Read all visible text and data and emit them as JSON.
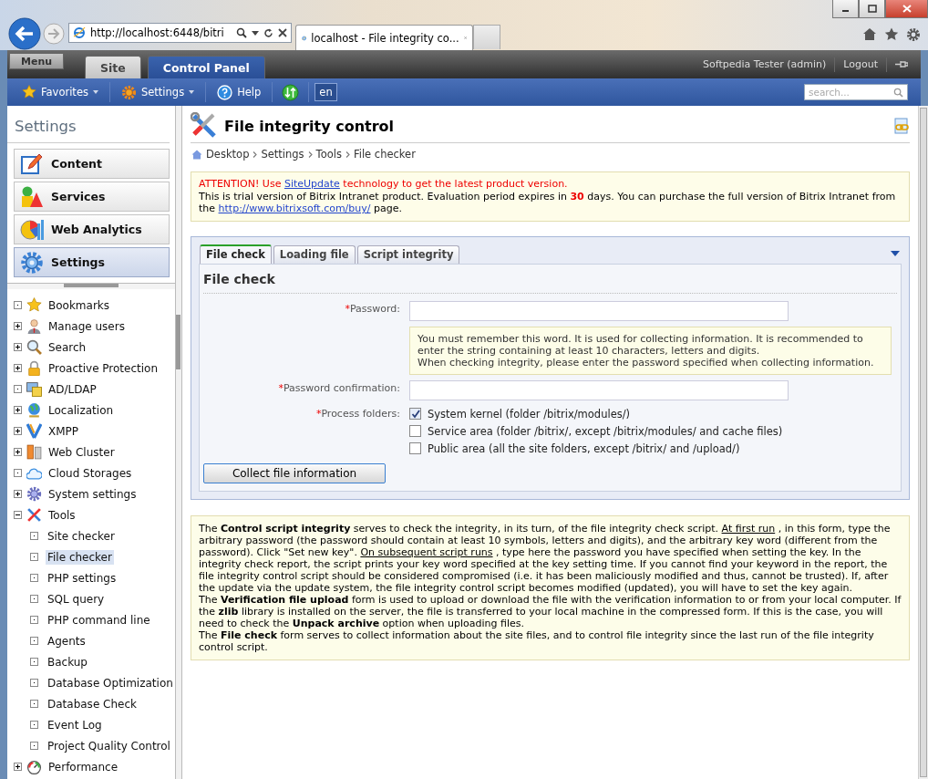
{
  "browser": {
    "address": "http://localhost:6448/bitri",
    "tab_title": "localhost - File integrity co..."
  },
  "admin_bar": {
    "menu": "Menu",
    "tabs": [
      {
        "label": "Site",
        "selected": false
      },
      {
        "label": "Control Panel",
        "selected": true
      }
    ],
    "user": "Softpedia Tester (admin)",
    "logout": "Logout"
  },
  "toolbar": {
    "items": [
      {
        "label": "Favorites",
        "dropdown": true
      },
      {
        "label": "Settings",
        "dropdown": true
      },
      {
        "label": "Help",
        "dropdown": false
      }
    ],
    "language": "en",
    "search": {
      "placeholder": "search..."
    }
  },
  "sidebar": {
    "title": "Settings",
    "sections": [
      {
        "label": "Content",
        "selected": false
      },
      {
        "label": "Services",
        "selected": false
      },
      {
        "label": "Web Analytics",
        "selected": false
      },
      {
        "label": "Settings",
        "selected": true
      }
    ],
    "tree": [
      {
        "label": "Bookmarks",
        "expandable": false,
        "selected": false
      },
      {
        "label": "Manage users",
        "expandable": true,
        "expanded": false,
        "selected": false
      },
      {
        "label": "Search",
        "expandable": true,
        "expanded": false,
        "selected": false
      },
      {
        "label": "Proactive Protection",
        "expandable": true,
        "expanded": false,
        "selected": false
      },
      {
        "label": "AD/LDAP",
        "expandable": false,
        "selected": false
      },
      {
        "label": "Localization",
        "expandable": true,
        "expanded": false,
        "selected": false
      },
      {
        "label": "XMPP",
        "expandable": true,
        "expanded": false,
        "selected": false
      },
      {
        "label": "Web Cluster",
        "expandable": true,
        "expanded": false,
        "selected": false
      },
      {
        "label": "Cloud Storages",
        "expandable": false,
        "selected": false
      },
      {
        "label": "System settings",
        "expandable": true,
        "expanded": false,
        "selected": false
      },
      {
        "label": "Tools",
        "expandable": true,
        "expanded": true,
        "selected": false,
        "children": [
          {
            "label": "Site checker",
            "selected": false
          },
          {
            "label": "File checker",
            "selected": true
          },
          {
            "label": "PHP settings",
            "selected": false
          },
          {
            "label": "SQL query",
            "selected": false
          },
          {
            "label": "PHP command line",
            "selected": false
          },
          {
            "label": "Agents",
            "selected": false
          },
          {
            "label": "Backup",
            "selected": false
          },
          {
            "label": "Database Optimization",
            "selected": false
          },
          {
            "label": "Database Check",
            "selected": false
          },
          {
            "label": "Event Log",
            "selected": false
          },
          {
            "label": "Project Quality Control",
            "selected": false
          }
        ]
      },
      {
        "label": "Performance",
        "expandable": true,
        "expanded": false,
        "selected": false
      }
    ]
  },
  "page": {
    "title": "File integrity control",
    "breadcrumb": [
      "Desktop",
      "Settings",
      "Tools",
      "File checker"
    ],
    "notice": {
      "attention": {
        "before": "ATTENTION! Use",
        "link": "SiteUpdate",
        "after": "technology to get the latest product version."
      },
      "trial": {
        "before": "This is trial version of Bitrix Intranet product. Evaluation period expires in **30** days. You can purchase the full version of Bitrix Intranet from the",
        "link": "http://www.bitrixsoft.com/buy/",
        "after": "page."
      }
    },
    "tabs": [
      {
        "label": "File check",
        "selected": true
      },
      {
        "label": "Loading file",
        "selected": false
      },
      {
        "label": "Script integrity",
        "selected": false
      }
    ],
    "form": {
      "heading": "File check",
      "password": {
        "label": "Password:",
        "required_mark": "*"
      },
      "hint": [
        "You must remember this word. It is used for collecting information. It is recommended to enter the string containing at least 10 characters, letters and digits.",
        "When checking integrity, please enter the password specified when collecting information."
      ],
      "confirmation": {
        "label": "Password confirmation:",
        "required_mark": "*"
      },
      "folders": {
        "label": "Process folders:",
        "required_mark": "*",
        "options": [
          {
            "label": "System kernel (folder /bitrix/modules/)",
            "checked": true
          },
          {
            "label": "Service area (folder /bitrix/, except /bitrix/modules/ and cache files)",
            "checked": false
          },
          {
            "label": "Public area (all the site folders, except /bitrix/ and /upload/)",
            "checked": false
          }
        ]
      },
      "button": "Collect file information"
    },
    "help": [
      [
        {
          "kind": "text",
          "text": "The **Control script integrity** serves to check the integrity, in its turn, of the file integrity check script."
        },
        {
          "kind": "underlined",
          "text": "At first run"
        },
        {
          "kind": "text",
          "text": ", in this form, type the arbitrary password (the password should contain at least 10 symbols, letters and digits), and the arbitrary key word (different from the password). Click \"Set new key\"."
        },
        {
          "kind": "underlined",
          "text": "On subsequent script runs"
        },
        {
          "kind": "text",
          "text": ", type here the password you have specified when setting the key. In the integrity check report, the script prints your key word specified at the key setting time. If you cannot find your keyword in the report, the file integrity control script should be considered compromised (i.e. it has been maliciously modified and thus, cannot be trusted). If, after the update via the update system, the file integrity control script becomes modified (updated), you will have to set the key again."
        }
      ],
      [
        {
          "kind": "text",
          "text": "The **Verification file upload** form is used to upload or download the file with the verification information to or from your local computer. If the **zlib** library is installed on the server, the file is transferred to your local machine in the compressed form. If this is the case, you will need to check the **Unpack archive** option when uploading files."
        }
      ],
      [
        {
          "kind": "text",
          "text": "The **File check** form serves to collect information about the site files, and to control file integrity since the last run of the file integrity control script."
        }
      ]
    ]
  }
}
